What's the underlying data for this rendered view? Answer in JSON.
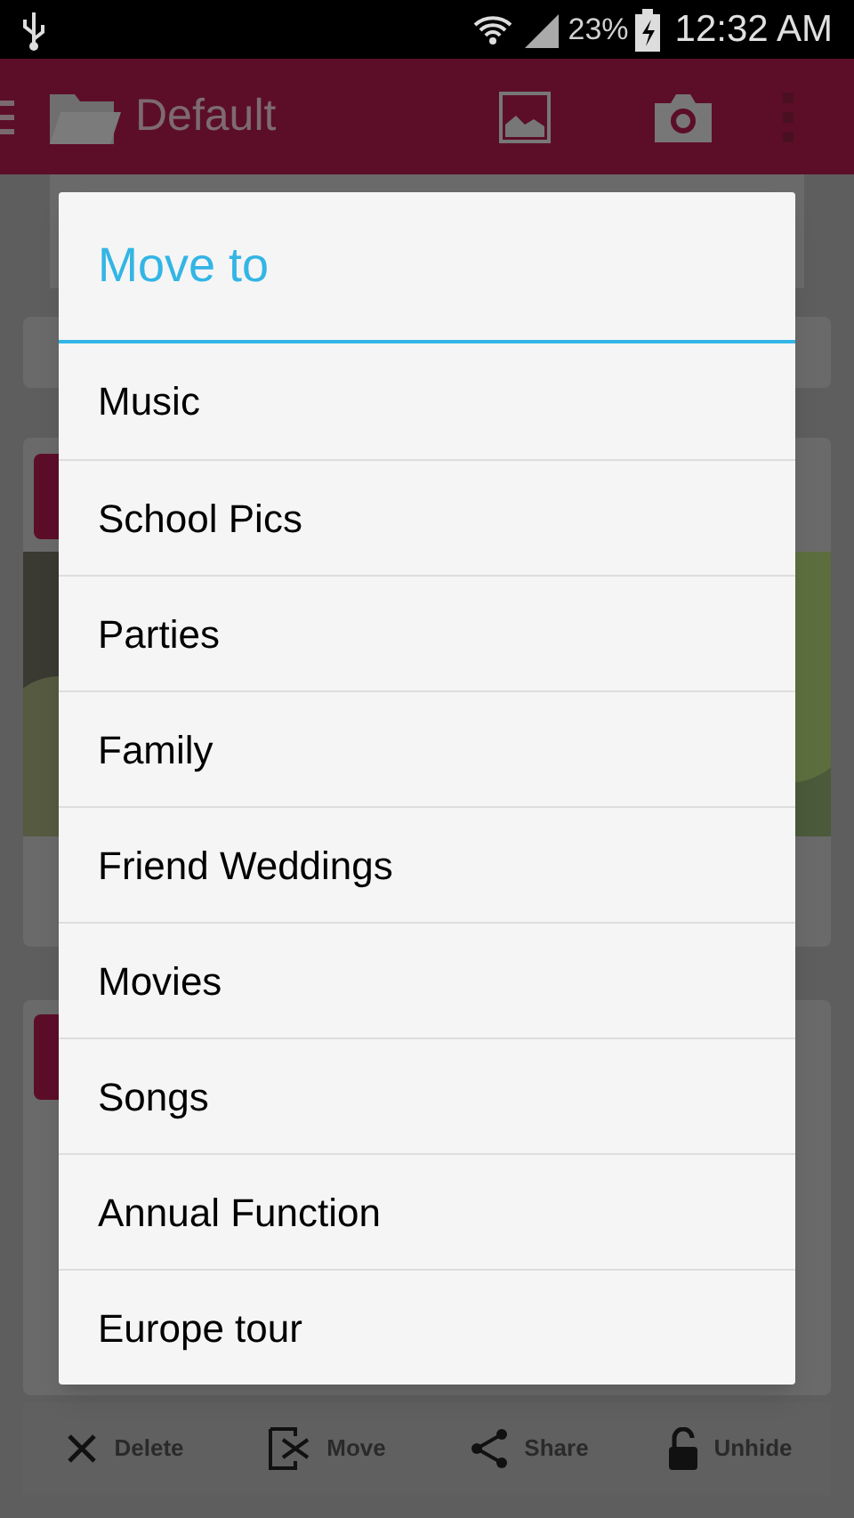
{
  "status_bar": {
    "battery": "23%",
    "time": "12:32 AM"
  },
  "app_bar": {
    "title": "Default"
  },
  "dialog": {
    "title": "Move to",
    "items": [
      {
        "label": "Music"
      },
      {
        "label": "School Pics"
      },
      {
        "label": "Parties"
      },
      {
        "label": "Family"
      },
      {
        "label": "Friend Weddings"
      },
      {
        "label": "Movies"
      },
      {
        "label": "Songs"
      },
      {
        "label": "Annual Function"
      },
      {
        "label": "Europe tour"
      }
    ]
  },
  "actions": [
    {
      "kind": "delete",
      "label": "Delete"
    },
    {
      "kind": "move",
      "label": "Move"
    },
    {
      "kind": "share",
      "label": "Share"
    },
    {
      "kind": "unhide",
      "label": "Unhide"
    }
  ]
}
